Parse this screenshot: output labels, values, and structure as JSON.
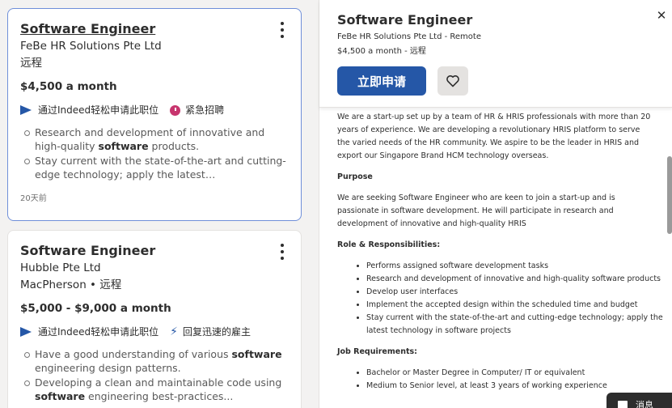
{
  "jobs": [
    {
      "title": "Software Engineer",
      "company": "FeBe HR Solutions Pte Ltd",
      "location": "远程",
      "salary": "$4,500 a month",
      "tags": [
        "通过Indeed轻松申请此职位",
        "紧急招聘"
      ],
      "bullets": [
        {
          "pre": "Research and development of innovative and high-quality ",
          "bold": "software",
          "post": " products."
        },
        {
          "pre": "Stay current with the state-of-the-art and cutting-edge technology; apply the latest…",
          "bold": "",
          "post": ""
        }
      ],
      "posted": "20天前"
    },
    {
      "title": "Software Engineer",
      "company": "Hubble Pte Ltd",
      "location": "MacPherson • 远程",
      "salary": "$5,000 - $9,000 a month",
      "tags": [
        "通过Indeed轻松申请此职位",
        "回复迅速的雇主"
      ],
      "bullets": [
        {
          "pre": "Have a good understanding of various ",
          "bold": "software",
          "post": " engineering design patterns."
        },
        {
          "pre": "Developing a clean and maintainable code using ",
          "bold": "software",
          "post": " engineering best-practices..."
        }
      ]
    }
  ],
  "detail": {
    "title": "Software Engineer",
    "company_line": "FeBe HR Solutions Pte Ltd - Remote",
    "salary_line": "$4,500 a month - 远程",
    "apply_label": "立即申请",
    "intro": "We are a start-up set up by a team of HR & HRIS professionals with more than 20 years of experience. We are developing a revolutionary HRIS platform to serve the varied needs of the HR community. We aspire to be the leader in HRIS and export our Singapore Brand HCM technology overseas.",
    "purpose_heading": "Purpose",
    "purpose_text": "We are seeking Software Engineer who are keen to join a start-up and is passionate in software development. He will participate in research and development of innovative and high-quality HRIS",
    "roles_heading": "Role & Responsibilities:",
    "roles": [
      "Performs assigned software development tasks",
      "Research and development of innovative and high-quality software products",
      "Develop user interfaces",
      "Implement the accepted design within the scheduled time and budget",
      "Stay current with the state-of-the-art and cutting-edge technology; apply the latest technology in software projects"
    ],
    "req_heading": "Job Requirements:",
    "requirements": [
      "Bachelor or Master Degree in Computer/ IT or equivalent",
      "Medium to Senior level, at least 3 years of working experience"
    ]
  },
  "toast": {
    "label": "消息"
  },
  "colors": {
    "accent": "#2557a7",
    "urgent": "#c7356e",
    "selected_border": "#6f8fd9"
  }
}
